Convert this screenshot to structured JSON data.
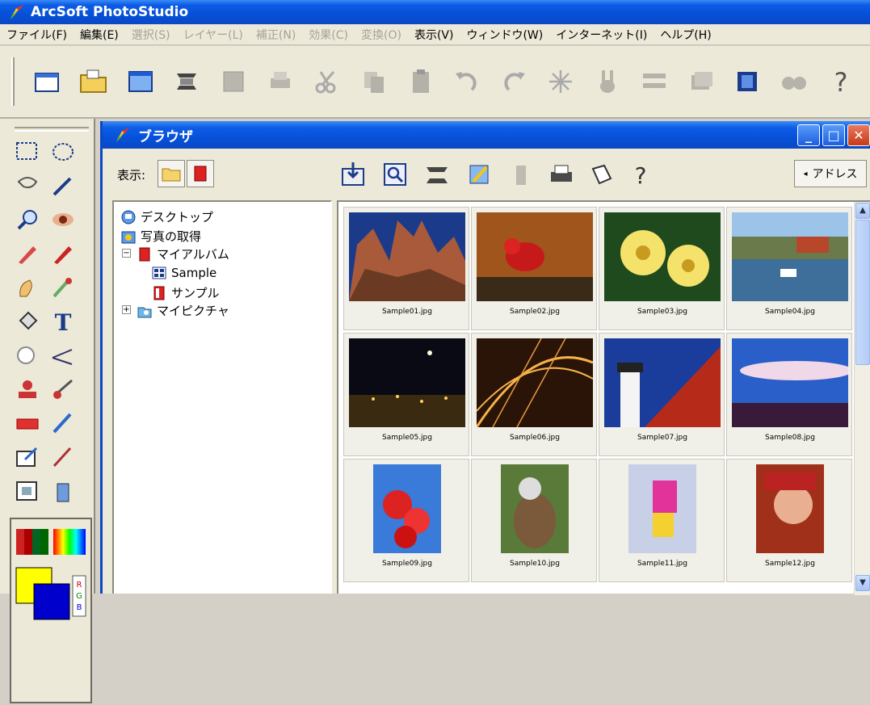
{
  "app": {
    "title": "ArcSoft PhotoStudio"
  },
  "menu": {
    "items": [
      {
        "label": "ファイル(F)",
        "enabled": true
      },
      {
        "label": "編集(E)",
        "enabled": true
      },
      {
        "label": "選択(S)",
        "enabled": false
      },
      {
        "label": "レイヤー(L)",
        "enabled": false
      },
      {
        "label": "補正(N)",
        "enabled": false
      },
      {
        "label": "効果(C)",
        "enabled": false
      },
      {
        "label": "変換(O)",
        "enabled": false
      },
      {
        "label": "表示(V)",
        "enabled": true
      },
      {
        "label": "ウィンドウ(W)",
        "enabled": true
      },
      {
        "label": "インターネット(I)",
        "enabled": true
      },
      {
        "label": "ヘルプ(H)",
        "enabled": true
      }
    ]
  },
  "browser": {
    "title": "ブラウザ",
    "show_label": "表示:",
    "address_label": "アドレス",
    "tree": {
      "desktop": "デスクトップ",
      "acquire": "写真の取得",
      "my_album": "マイアルバム",
      "sample": "Sample",
      "sample_jp": "サンプル",
      "my_pictures": "マイピクチャ"
    },
    "thumbnails": [
      "Sample01.jpg",
      "Sample02.jpg",
      "Sample03.jpg",
      "Sample04.jpg",
      "Sample05.jpg",
      "Sample06.jpg",
      "Sample07.jpg",
      "Sample08.jpg",
      "Sample09.jpg",
      "Sample10.jpg",
      "Sample11.jpg",
      "Sample12.jpg"
    ]
  },
  "colors": {
    "title_blue": "#0650d8",
    "chrome": "#ece9d8",
    "close_red": "#c73a18"
  }
}
